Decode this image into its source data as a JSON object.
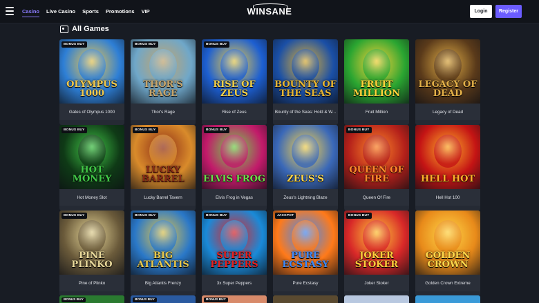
{
  "nav": {
    "items": [
      {
        "label": "Casino",
        "active": true
      },
      {
        "label": "Live Casino",
        "active": false
      },
      {
        "label": "Sports",
        "active": false
      },
      {
        "label": "Promotions",
        "active": false
      },
      {
        "label": "VIP",
        "active": false
      }
    ],
    "logo": "WINSANE",
    "login_label": "Login",
    "register_label": "Register"
  },
  "section": {
    "title": "All Games",
    "icon": "games-icon"
  },
  "games": [
    {
      "name": "Gates of Olympus 1000",
      "badge": "BONUS BUY",
      "art_title": "OLYMPUS 1000",
      "colors": [
        "#2e7fd6",
        "#f2c94c"
      ]
    },
    {
      "name": "Thor's Rage",
      "badge": "BONUS BUY",
      "art_title": "THOR'S RAGE",
      "colors": [
        "#6fa7c9",
        "#c7a56a"
      ]
    },
    {
      "name": "Rise of Zeus",
      "badge": "BONUS BUY",
      "art_title": "RISE OF ZEUS",
      "colors": [
        "#1d5fd1",
        "#f2d048"
      ]
    },
    {
      "name": "Bounty of the Seas: Hold & W...",
      "badge": "",
      "art_title": "BOUNTY OF THE SEAS",
      "colors": [
        "#1a4fa6",
        "#e7b532"
      ]
    },
    {
      "name": "Fruit Million",
      "badge": "",
      "art_title": "FRUIT MILLION",
      "colors": [
        "#2aa531",
        "#ffd23a"
      ]
    },
    {
      "name": "Legacy of Dead",
      "badge": "",
      "art_title": "LEGACY OF DEAD",
      "colors": [
        "#5a3a1a",
        "#e3b048"
      ]
    },
    {
      "name": "Hot Money Slot",
      "badge": "BONUS BUY",
      "art_title": "HOT MONEY",
      "colors": [
        "#0f3a16",
        "#42c948"
      ]
    },
    {
      "name": "Lucky Barrel Tavern",
      "badge": "BONUS BUY",
      "art_title": "LUCKY BARREL",
      "colors": [
        "#d98b2b",
        "#8a2a16"
      ]
    },
    {
      "name": "Elvis Frog in Vegas",
      "badge": "BONUS BUY",
      "art_title": "ELVIS FROG",
      "colors": [
        "#c21a6a",
        "#6ae04a"
      ]
    },
    {
      "name": "Zeus's Lightning Blaze",
      "badge": "",
      "art_title": "ZEUS'S",
      "colors": [
        "#3a68b8",
        "#ffd84a"
      ]
    },
    {
      "name": "Queen Of Fire",
      "badge": "BONUS BUY",
      "art_title": "QUEEN OF FIRE",
      "colors": [
        "#b4201a",
        "#ff8a2a"
      ]
    },
    {
      "name": "Hell Hot 100",
      "badge": "",
      "art_title": "HELL HOT",
      "colors": [
        "#c41414",
        "#ffb22a"
      ]
    },
    {
      "name": "Pine of Plinko",
      "badge": "BONUS BUY",
      "art_title": "PINE PLINKO",
      "colors": [
        "#6a5a3a",
        "#e8d89a"
      ]
    },
    {
      "name": "Big Atlantis Frenzy",
      "badge": "BONUS BUY",
      "art_title": "BIG ATLANTIS",
      "colors": [
        "#2a78c8",
        "#e8c84a"
      ]
    },
    {
      "name": "3x Super Peppers",
      "badge": "BONUS BUY",
      "art_title": "SUPER PEPPERS",
      "colors": [
        "#1a8ad8",
        "#e82020"
      ]
    },
    {
      "name": "Pure Ecstasy",
      "badge": "JACKPOT",
      "art_title": "PURE ECSTASY",
      "colors": [
        "#ff7a1a",
        "#3a8aff"
      ]
    },
    {
      "name": "Joker Stoker",
      "badge": "BONUS BUY",
      "art_title": "JOKER STOKER",
      "colors": [
        "#d82828",
        "#ffcf3a"
      ]
    },
    {
      "name": "Golden Crown Extreme",
      "badge": "",
      "art_title": "GOLDEN CROWN",
      "colors": [
        "#e88a1a",
        "#ffd84a"
      ]
    }
  ],
  "partial_row": [
    {
      "badge": "BONUS BUY",
      "color": "#2a7a30"
    },
    {
      "badge": "BONUS BUY",
      "color": "#2a5aa0"
    },
    {
      "badge": "BONUS BUY",
      "color": "#d88a6a"
    },
    {
      "badge": "",
      "color": "#5a4a30"
    },
    {
      "badge": "",
      "color": "#b8c8e0"
    },
    {
      "badge": "",
      "color": "#3a9ad8"
    }
  ]
}
